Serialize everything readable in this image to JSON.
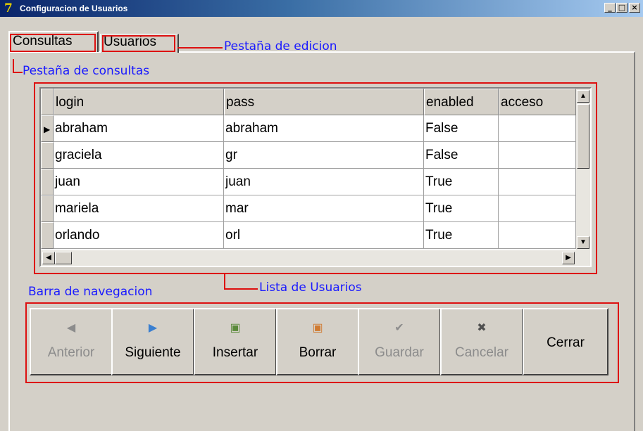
{
  "window": {
    "title": "Configuracion de Usuarios",
    "icon_glyph": "7",
    "buttons": {
      "minimize": "_",
      "maximize": "□",
      "close": "×"
    }
  },
  "tabs": [
    {
      "label": "Consultas",
      "active": true
    },
    {
      "label": "Usuarios",
      "active": false
    }
  ],
  "annotations": {
    "edit_tab": "Pestaña de edicion",
    "query_tab": "Pestaña de consultas",
    "user_list": "Lista de Usuarios",
    "nav_bar": "Barra de navegacion",
    "color": "#1a1aff",
    "highlight_color": "#dd1010"
  },
  "grid": {
    "columns": [
      "login",
      "pass",
      "enabled",
      "acceso"
    ],
    "rows": [
      [
        "abraham",
        "abraham",
        "False",
        ""
      ],
      [
        "graciela",
        "gr",
        "False",
        ""
      ],
      [
        "juan",
        "juan",
        "True",
        ""
      ],
      [
        "mariela",
        "mar",
        "True",
        ""
      ],
      [
        "orlando",
        "orl",
        "True",
        ""
      ]
    ],
    "current_row_indicator": "▶",
    "scroll": {
      "up": "▲",
      "down": "▼",
      "left": "◀",
      "right": "▶"
    }
  },
  "nav": {
    "buttons": [
      {
        "label": "Anterior",
        "icon": "◀",
        "icon_name": "previous-icon",
        "enabled": false
      },
      {
        "label": "Siguiente",
        "icon": "▶",
        "icon_name": "next-icon",
        "enabled": true
      },
      {
        "label": "Insertar",
        "icon": "▣",
        "icon_name": "insert-icon",
        "enabled": true
      },
      {
        "label": "Borrar",
        "icon": "▣",
        "icon_name": "delete-icon",
        "enabled": true
      },
      {
        "label": "Guardar",
        "icon": "✔",
        "icon_name": "check-icon",
        "enabled": false
      },
      {
        "label": "Cancelar",
        "icon": "✖",
        "icon_name": "cancel-icon",
        "enabled": false
      },
      {
        "label": "Cerrar",
        "icon": "",
        "icon_name": "",
        "enabled": true
      }
    ]
  }
}
